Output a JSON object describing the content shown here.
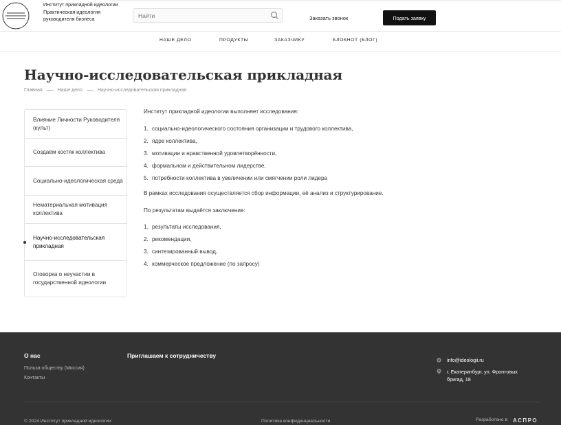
{
  "header": {
    "org_name": "Институт прикладной идеологии",
    "slogan": "Практическая идеология руководителя бизнеса",
    "search_placeholder": "Найти",
    "callback_label": "Заказать звонок",
    "apply_label": "Подать заявку"
  },
  "nav": [
    "НАШЕ ДЕЛО",
    "ПРОДУКТЫ",
    "ЗАКАЗЧИКУ",
    "БЛОКНОТ (БЛОГ)"
  ],
  "page": {
    "title": "Научно-исследовательская прикладная",
    "breadcrumbs": [
      "Главная",
      "Наше дело",
      "Научно-исследовательская прикладная"
    ]
  },
  "sidebar": {
    "items": [
      "Влияние Личности Руководителя (культ)",
      "Создаём костяк коллектива",
      "Социально-идеологическая среда",
      "Нематериальная мотивация коллектива",
      "Научно-исследовательская прикладная",
      "Оговорка о неучастии в государственной идеологии"
    ],
    "active_index": 4
  },
  "content": {
    "intro": "Институт прикладной идеологии выполняет исследования:",
    "research_list": [
      "социально-идеологического состояния организации и трудового коллектива,",
      "ядре коллектива,",
      "мотивации и нравственной удовлетворённости,",
      "формальном и действительном лидерстве,",
      "потребности коллектива в увеличении или смягчении роли лидера"
    ],
    "process": "В рамках исследования осуществляется сбор информации, её анализ и структурирование.",
    "results_intro": "По результатам выдаётся заключение:",
    "results_list": [
      "результаты исследования,",
      "рекомендации,",
      "синтезированный вывод,",
      "коммерческое предложение (по запросу)"
    ]
  },
  "footer": {
    "about_heading": "О нас",
    "about_links": [
      "Польза обществу (Миссия)",
      "Контакты"
    ],
    "cooperation_heading": "Приглашаем к сотрудничеству",
    "email": "info@ideologii.ru",
    "address": "г. Екатеринбург, ул. Фронтовых бригад, 18",
    "copyright": "© 2024 Институт прикладной идеологии",
    "privacy": "Политика конфиденциальности",
    "developed_by": "Разработано в",
    "developer": "АСПРО"
  }
}
